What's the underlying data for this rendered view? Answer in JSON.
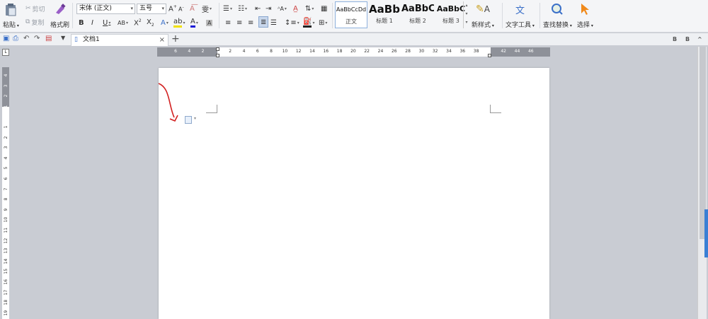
{
  "clipboard": {
    "paste_label": "粘贴",
    "cut_label": "剪切",
    "copy_label": "复制",
    "format_painter_label": "格式刷"
  },
  "font": {
    "family_value": "宋体 (正文)",
    "size_value": "五号"
  },
  "styles": [
    {
      "preview": "AaBbCcDd",
      "name": "正文"
    },
    {
      "preview": "AaBb",
      "name": "标题 1"
    },
    {
      "preview": "AaBbC",
      "name": "标题 2"
    },
    {
      "preview": "AaBbC",
      "name": "标题 3"
    }
  ],
  "tools": {
    "new_style_label": "新样式",
    "text_tools_label": "文字工具",
    "find_replace_label": "查找替换",
    "select_label": "选择"
  },
  "tab": {
    "doc_title": "文档1"
  },
  "ruler": {
    "h_ticks": [
      "6",
      "4",
      "2",
      "",
      "2",
      "4",
      "6",
      "8",
      "10",
      "12",
      "14",
      "16",
      "18",
      "20",
      "22",
      "24",
      "26",
      "28",
      "30",
      "32",
      "34",
      "36",
      "38",
      "",
      "42",
      "44",
      "46"
    ],
    "v_ticks": [
      "4",
      "3",
      "2",
      "1",
      "",
      "1",
      "2",
      "3",
      "4",
      "5",
      "6",
      "7",
      "8",
      "9",
      "10",
      "11",
      "12",
      "13",
      "14",
      "15",
      "16",
      "17",
      "18",
      "19"
    ]
  },
  "colors": {
    "accent": "#3a7fd4",
    "annotation_arrow": "#d22020",
    "font_color_underline": "#1a1ad6",
    "highlight": "#f0e000"
  }
}
